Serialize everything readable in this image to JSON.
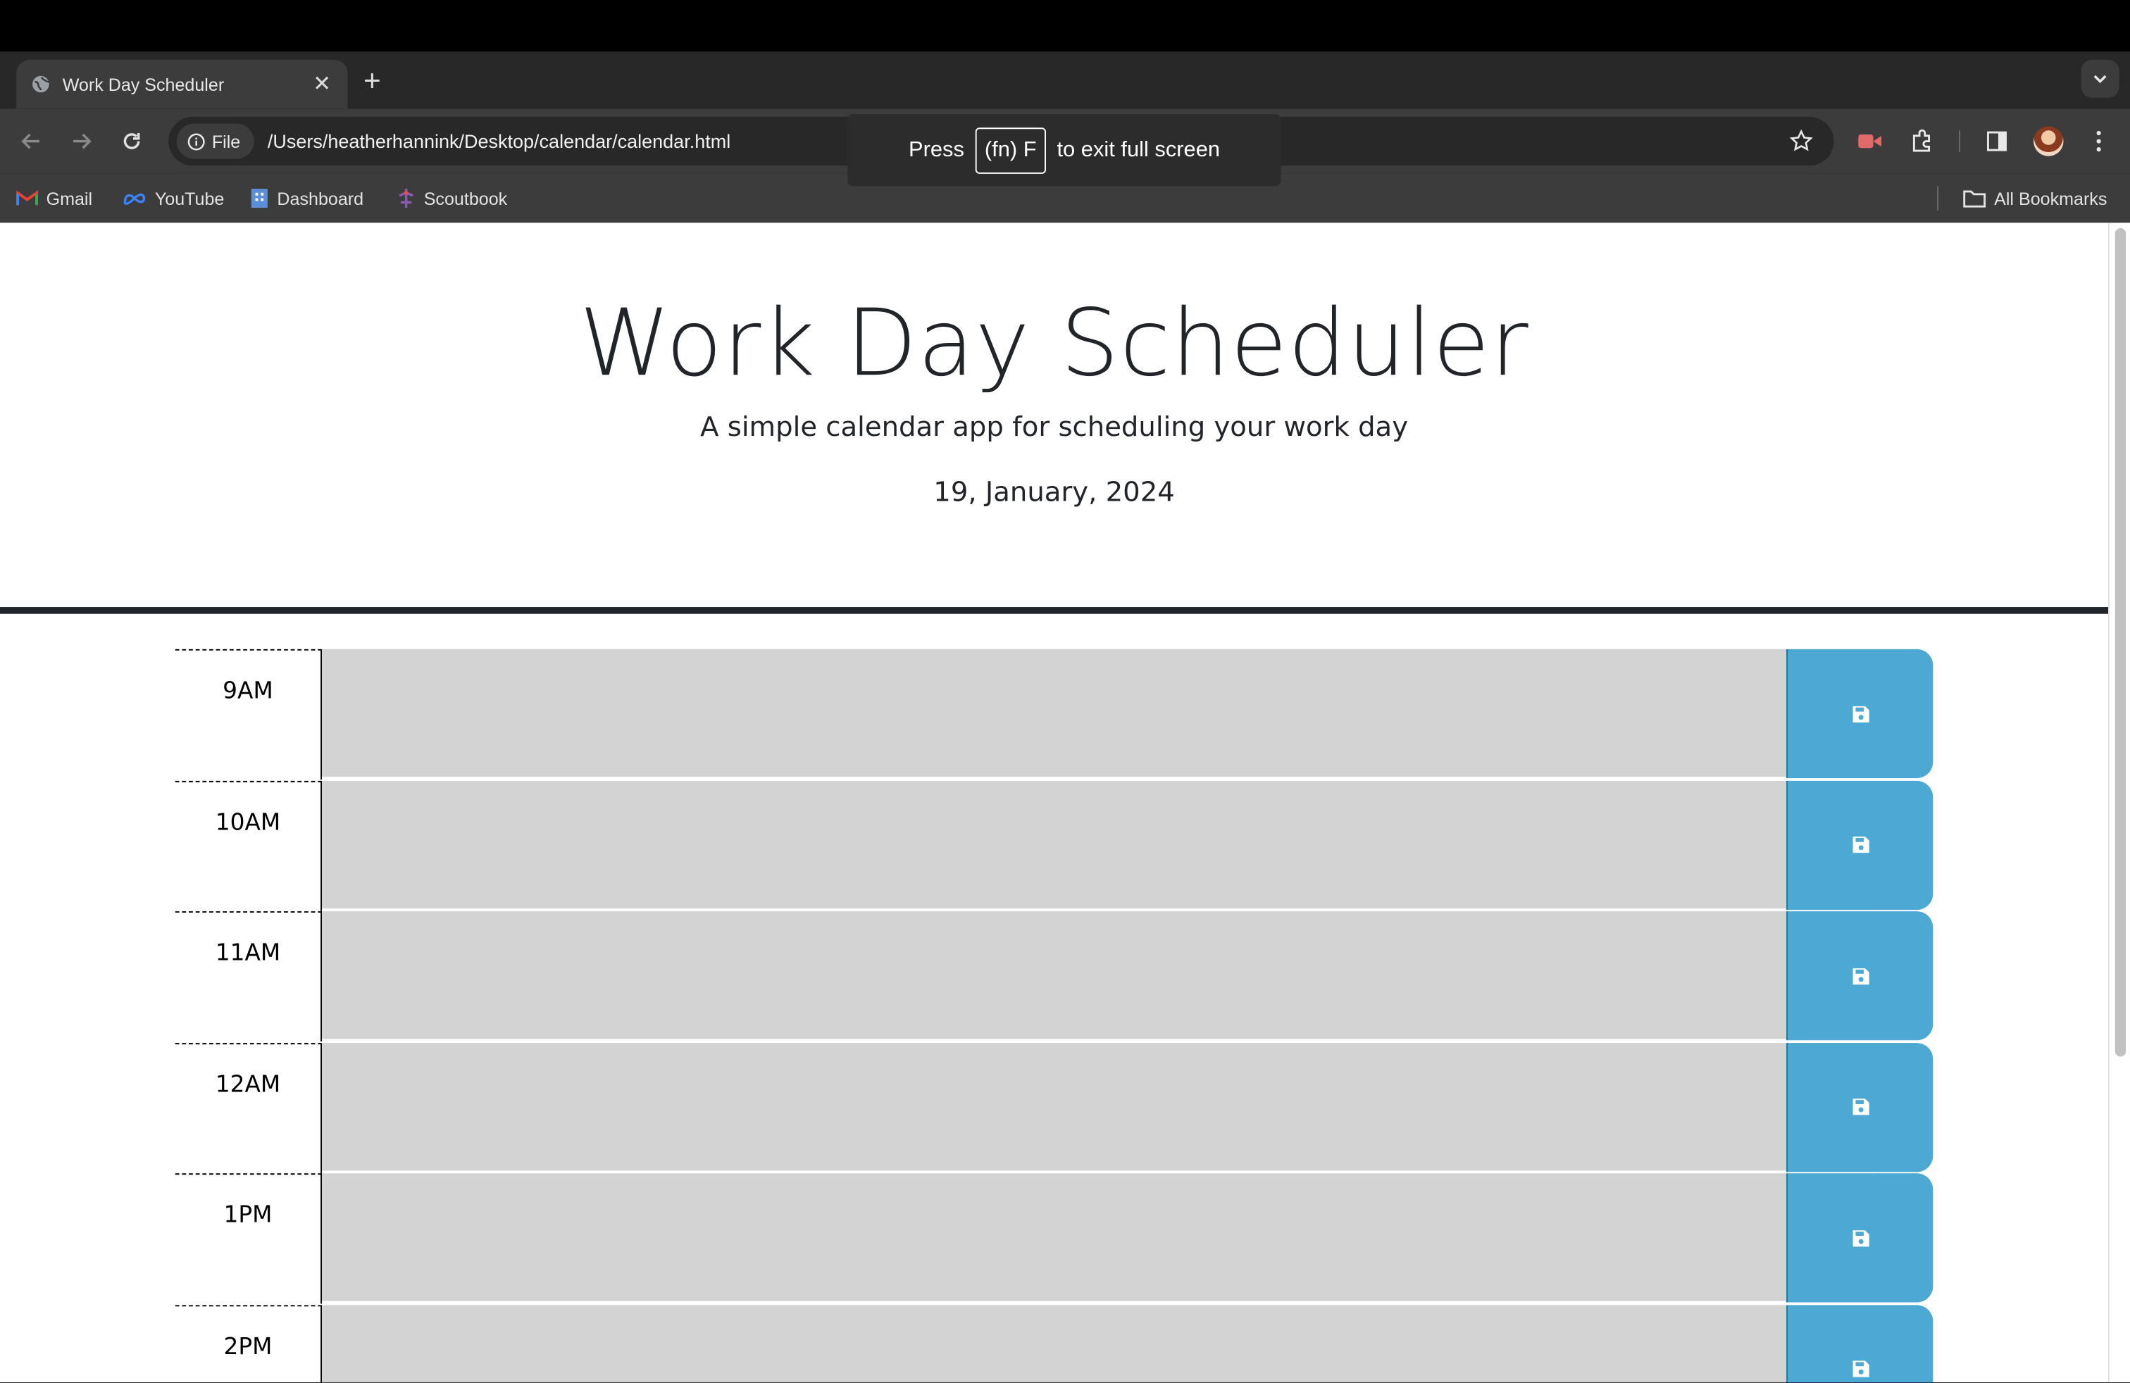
{
  "browser": {
    "tab_title": "Work Day Scheduler",
    "url_chip": "File",
    "url": "/Users/heatherhannink/Desktop/calendar/calendar.html",
    "fullscreen_notice": {
      "before": "Press",
      "key": "(fn) F",
      "after": "to exit full screen"
    },
    "bookmarks": [
      "Gmail",
      "YouTube",
      "Dashboard",
      "Scoutbook"
    ],
    "all_bookmarks": "All Bookmarks"
  },
  "page": {
    "title": "Work Day Scheduler",
    "lead": "A simple calendar app for scheduling your work day",
    "current_day": "19, January, 2024"
  },
  "hours": [
    {
      "label": "9AM",
      "text": ""
    },
    {
      "label": "10AM",
      "text": ""
    },
    {
      "label": "11AM",
      "text": ""
    },
    {
      "label": "12AM",
      "text": ""
    },
    {
      "label": "1PM",
      "text": ""
    },
    {
      "label": "2PM",
      "text": ""
    }
  ],
  "colors": {
    "past_row": "#d3d3d3",
    "save_button": "#4ba9d4"
  }
}
